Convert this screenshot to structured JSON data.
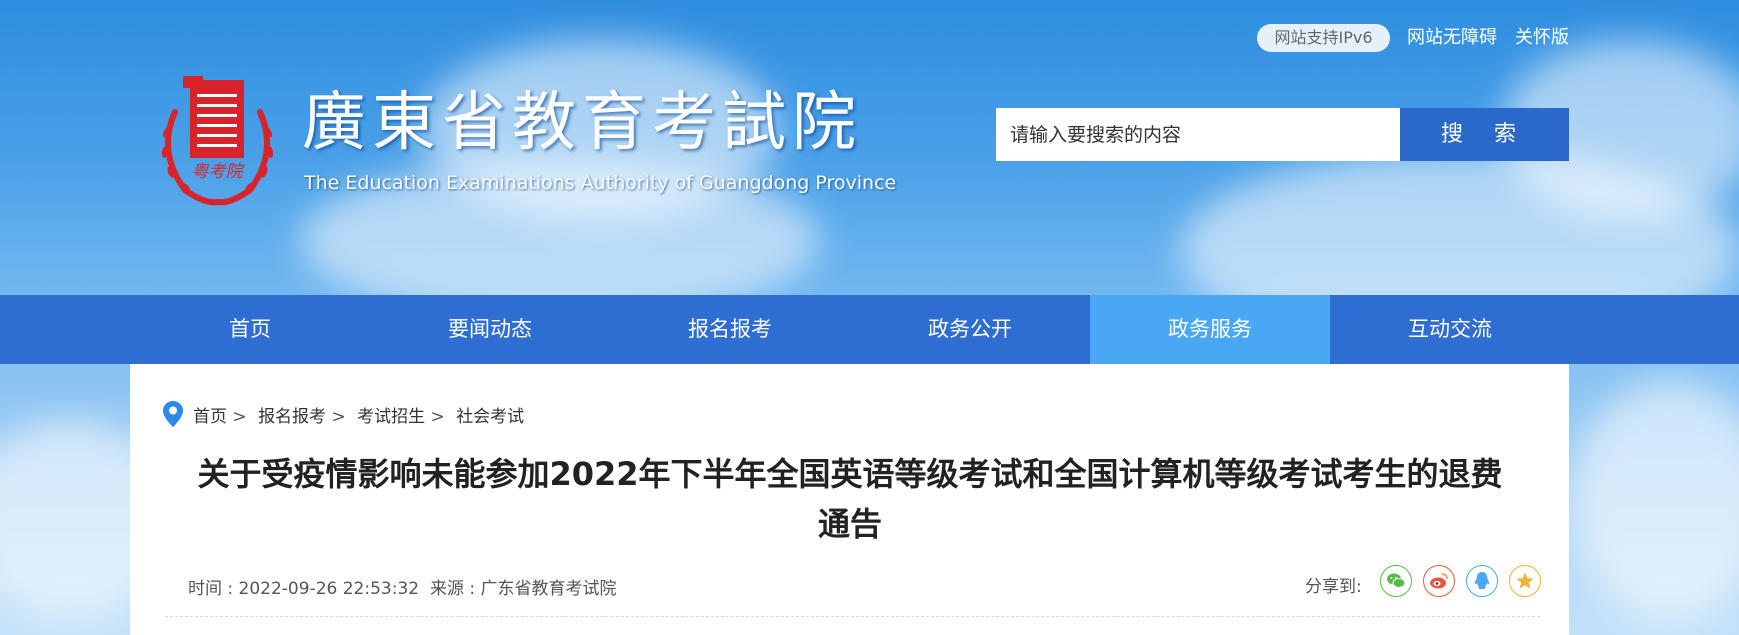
{
  "header": {
    "ipv6_badge": "网站支持IPv6",
    "accessibility_link": "网站无障碍",
    "care_mode_link": "关怀版",
    "logo_cn": "廣東省教育考試院",
    "logo_en": "The Education Examinations Authority of Guangdong Province",
    "emblem_text": "粤考院"
  },
  "search": {
    "placeholder": "请输入要搜索的内容",
    "button_label": "搜  索"
  },
  "nav": {
    "items": [
      {
        "label": "首页"
      },
      {
        "label": "要闻动态"
      },
      {
        "label": "报名报考"
      },
      {
        "label": "政务公开"
      },
      {
        "label": "政务服务"
      },
      {
        "label": "互动交流"
      }
    ],
    "active_index": 4
  },
  "breadcrumb": [
    "首页",
    "报名报考",
    "考试招生",
    "社会考试"
  ],
  "breadcrumb_separator": ">",
  "article": {
    "title_line1": "关于受疫情影响未能参加2022年下半年全国英语等级考试和全国计算机等级考试考生的退费",
    "title_line2": "通告",
    "time": "时间 : 2022-09-26 22:53:32",
    "source": "来源 : 广东省教育考试院",
    "share_label": "分享到:"
  },
  "share_icons": [
    "wechat-icon",
    "weibo-icon",
    "qq-icon",
    "qzone-icon"
  ],
  "colors": {
    "nav_bg": "#2e6dd1",
    "nav_active": "#4aa7f4",
    "search_button": "#2a69c9",
    "emblem_red": "#d9232a",
    "wechat": "#5bb84a",
    "weibo": "#e8573f",
    "qq": "#4aa9f0",
    "qzone": "#f2b136"
  }
}
